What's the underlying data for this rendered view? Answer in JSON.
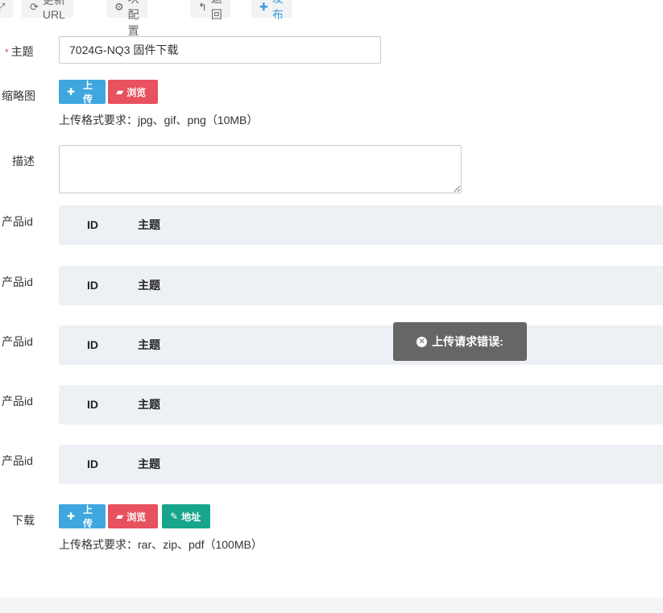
{
  "toolbar": {
    "update_url": "更新URL",
    "module_config": "模块配置",
    "back": "返回",
    "publish": "发布"
  },
  "form": {
    "subject_label": "主题",
    "subject_required_mark": "*",
    "subject_value": "7024G-NQ3 固件下载",
    "thumbnail_label": "缩略图",
    "upload_label": "上传",
    "browse_label": "浏览",
    "thumbnail_hint": "上传格式要求：jpg、gif、png（10MB）",
    "description_label": "描述",
    "description_value": "",
    "product_id_label": "产品id",
    "product_tables": [
      {
        "col_id": "ID",
        "col_subject": "主题"
      },
      {
        "col_id": "ID",
        "col_subject": "主题"
      },
      {
        "col_id": "ID",
        "col_subject": "主题"
      },
      {
        "col_id": "ID",
        "col_subject": "主题"
      },
      {
        "col_id": "ID",
        "col_subject": "主题"
      }
    ],
    "download_label": "下载",
    "address_label": "地址",
    "download_hint": "上传格式要求：rar、zip、pdf（100MB）"
  },
  "toast": {
    "message": "上传请求错误:",
    "icon": "close-circle-icon"
  },
  "colors": {
    "blue": "#3fa7de",
    "red": "#e8515e",
    "teal": "#17a68b",
    "toast_bg": "#666666",
    "table_bg": "#edf1f5"
  }
}
